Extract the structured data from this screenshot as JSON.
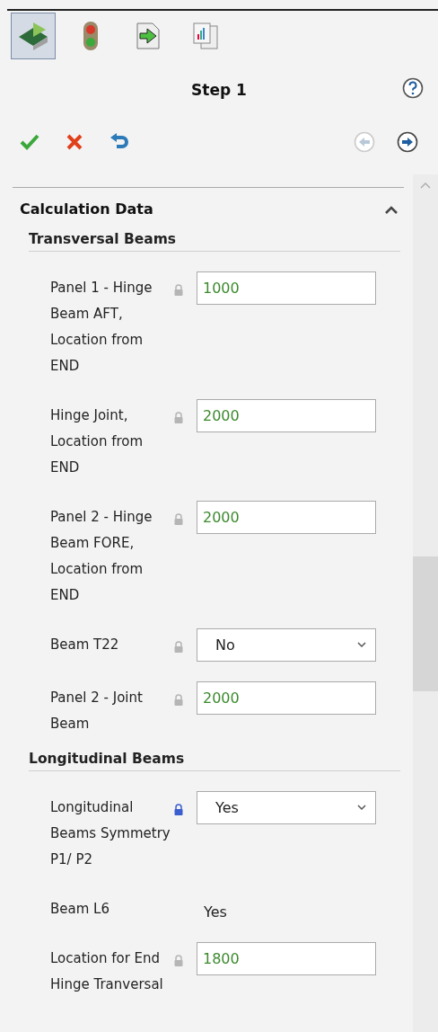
{
  "toolbar": [
    {
      "selected": true
    },
    {
      "selected": false
    },
    {
      "selected": false
    },
    {
      "selected": false
    }
  ],
  "step": {
    "title": "Step 1"
  },
  "actions": [
    {
      "kind": "accept"
    },
    {
      "kind": "cancel"
    },
    {
      "kind": "undo"
    }
  ],
  "navigation": [
    {
      "kind": "back",
      "disabled": true
    },
    {
      "kind": "forward",
      "disabled": false
    }
  ],
  "section": {
    "title": "Calculation Data",
    "expanded": true,
    "groups": [
      {
        "title": "Transversal Beams",
        "rows": [
          {
            "label": "Panel 1 - Hinge Beam AFT, Location from END",
            "kind": "text",
            "value": "1000",
            "lock_highlighted": false
          },
          {
            "label": "Hinge Joint, Location from END",
            "kind": "text",
            "value": "2000",
            "lock_highlighted": false
          },
          {
            "label": "Panel 2 - Hinge Beam FORE, Location from END",
            "kind": "text",
            "value": "2000",
            "lock_highlighted": false
          },
          {
            "label": "Beam T22",
            "kind": "select",
            "value": "No",
            "lock_highlighted": false
          },
          {
            "label": "Panel 2 - Joint Beam",
            "kind": "text",
            "value": "2000",
            "lock_highlighted": false
          }
        ]
      },
      {
        "title": "Longitudinal Beams",
        "rows": [
          {
            "label": "Longitudinal Beams Symmetry P1/ P2",
            "kind": "select",
            "value": "Yes",
            "lock_highlighted": true
          },
          {
            "label": "Beam L6",
            "kind": "readonly",
            "value": "Yes"
          },
          {
            "label": "Location for End Hinge Tranversal",
            "kind": "text",
            "value": "1800",
            "lock_highlighted": false
          }
        ]
      }
    ]
  }
}
